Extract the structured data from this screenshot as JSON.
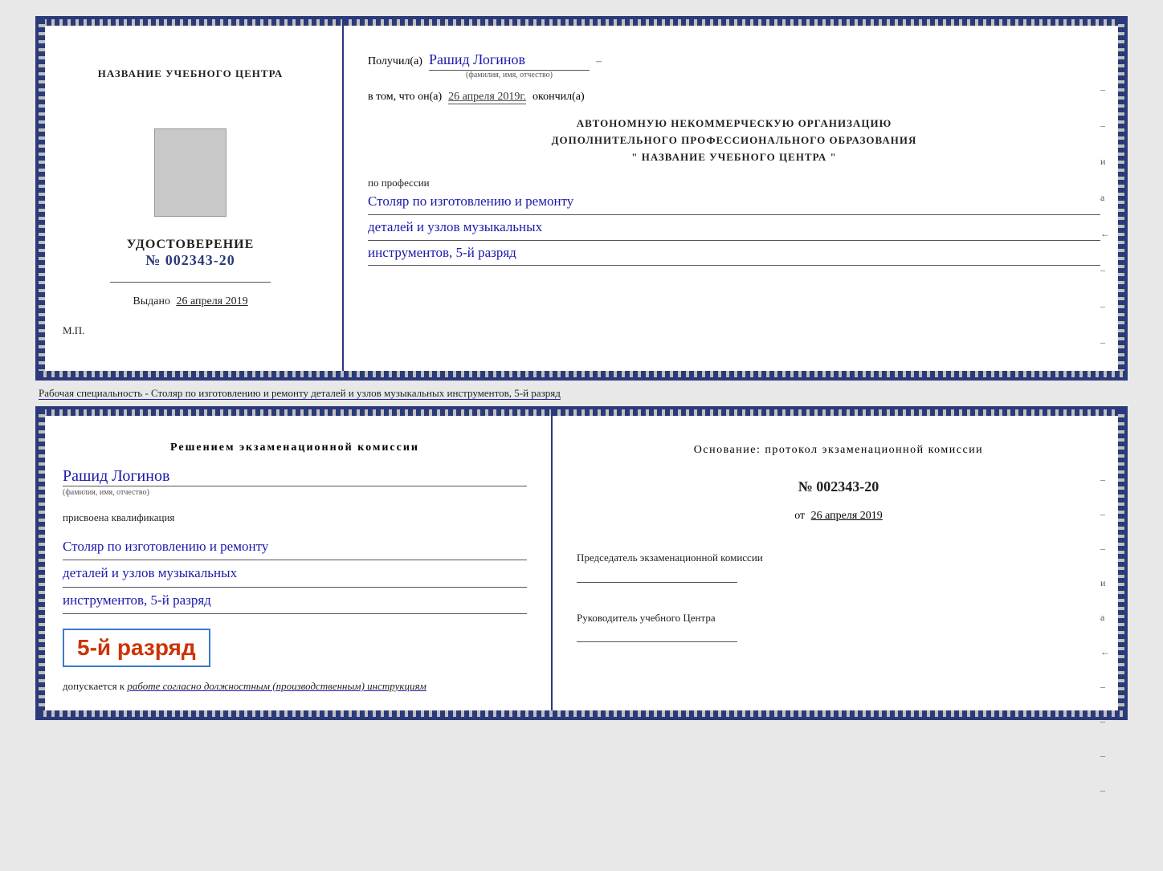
{
  "top_document": {
    "left": {
      "center_name_label": "НАЗВАНИЕ УЧЕБНОГО ЦЕНТРА",
      "certificate_label": "УДОСТОВЕРЕНИЕ",
      "cert_number": "№ 002343-20",
      "vydano_label": "Выдано",
      "vydano_date": "26 апреля 2019",
      "mp_label": "М.П."
    },
    "right": {
      "poluchil_label": "Получил(а)",
      "recipient_name": "Рашид Логинов",
      "fio_label": "(фамилия, имя, отчество)",
      "dash": "–",
      "v_tom_label": "в том, что он(а)",
      "date_value": "26 апреля 2019г.",
      "okonchil_label": "окончил(а)",
      "org_line1": "АВТОНОМНУЮ НЕКОММЕРЧЕСКУЮ ОРГАНИЗАЦИЮ",
      "org_line2": "ДОПОЛНИТЕЛЬНОГО ПРОФЕССИОНАЛЬНОГО ОБРАЗОВАНИЯ",
      "org_line3": "\"  НАЗВАНИЕ УЧЕБНОГО ЦЕНТРА  \"",
      "po_professii_label": "по профессии",
      "profession_line1": "Столяр по изготовлению и ремонту",
      "profession_line2": "деталей и узлов музыкальных",
      "profession_line3": "инструментов, 5-й разряд"
    }
  },
  "separator": {
    "text": "Рабочая специальность - Столяр по изготовлению и ремонту деталей и узлов музыкальных инструментов, 5-й разряд"
  },
  "bottom_document": {
    "left": {
      "decision_label": "Решением экзаменационной комиссии",
      "person_name": "Рашид Логинов",
      "fio_label": "(фамилия, имя, отчество)",
      "prisvoena_label": "присвоена квалификация",
      "qualification_line1": "Столяр по изготовлению и ремонту",
      "qualification_line2": "деталей и узлов музыкальных",
      "qualification_line3": "инструментов, 5-й разряд",
      "rank_text": "5-й разряд",
      "dopuskaetsya_label": "допускается к",
      "dopusk_value": "работе согласно должностным (производственным) инструкциям"
    },
    "right": {
      "osnov_label": "Основание: протокол экзаменационной комиссии",
      "protocol_number": "№ 002343-20",
      "ot_label": "от",
      "protocol_date": "26 апреля 2019",
      "chairman_label": "Председатель экзаменационной комиссии",
      "rukovod_label": "Руководитель учебного Центра"
    }
  }
}
